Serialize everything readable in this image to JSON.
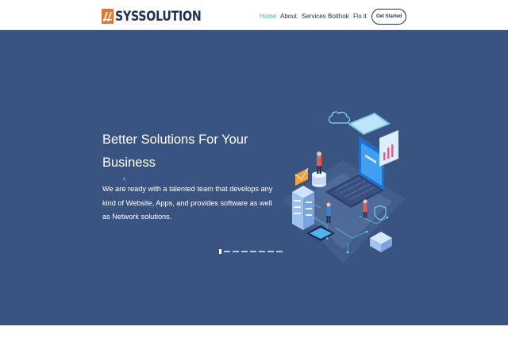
{
  "brand": {
    "name": "SYSSOLUTION",
    "logo_icon": "sys-logo-icon",
    "accent": "#e2762a",
    "navy": "#1c2e5a"
  },
  "nav": {
    "items": [
      {
        "label": "Home",
        "active": true
      },
      {
        "label": "About",
        "active": false
      },
      {
        "label": "Services",
        "active": false
      },
      {
        "label": "Boithok",
        "active": false
      },
      {
        "label": "Fix it",
        "active": false
      }
    ],
    "cta_label": "Get Started"
  },
  "hero": {
    "title_line1": "Better Solutions For Your",
    "title_line2": "Business",
    "description": "We are ready with a talented team that develops any kind of Website, Apps, and provides software as well as Network solutions.",
    "prev_arrow": "‹",
    "background": "#3a5482",
    "slides": {
      "count": 8,
      "active_index": 0
    },
    "illustration": "isometric-network-illustration"
  }
}
